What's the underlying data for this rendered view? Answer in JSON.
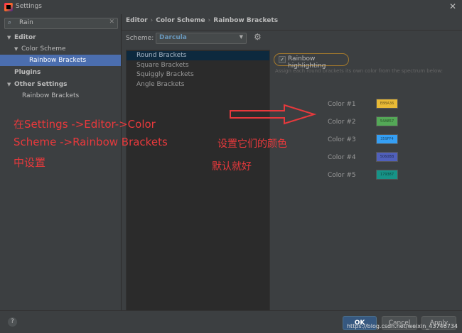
{
  "window": {
    "title": "Settings",
    "close_icon": "close-icon"
  },
  "sidebar": {
    "search_value": "Rain",
    "items": [
      {
        "label": "Editor"
      },
      {
        "label": "Color Scheme"
      },
      {
        "label": "Rainbow Brackets"
      },
      {
        "label": "Plugins"
      },
      {
        "label": "Other Settings"
      },
      {
        "label": "Rainbow Brackets"
      }
    ]
  },
  "breadcrumb": [
    "Editor",
    "Color Scheme",
    "Rainbow Brackets"
  ],
  "scheme": {
    "label": "Scheme:",
    "value": "Darcula"
  },
  "bracket_types": [
    "Round Brackets",
    "Square Brackets",
    "Squiggly Brackets",
    "Angle Brackets"
  ],
  "rainbow": {
    "label": "Rainbow highlighting",
    "checked": true,
    "description": "Assign each round brackets its own color from the spectrum below:"
  },
  "colors": [
    {
      "label": "Color #1",
      "hex": "#E8BA36",
      "code": "E8BA36"
    },
    {
      "label": "Color #2",
      "hex": "#54A857",
      "code": "54A857"
    },
    {
      "label": "Color #3",
      "hex": "#359FF4",
      "code": "359FF4"
    },
    {
      "label": "Color #4",
      "hex": "#5060BB",
      "code": "5060BB"
    },
    {
      "label": "Color #5",
      "hex": "#179387",
      "code": "179387"
    }
  ],
  "annotations": {
    "left_line1": "在Settings ->Editor->Color",
    "left_line2": "Scheme ->Rainbow Brackets",
    "left_line3": "中设置",
    "right_line1": "设置它们的颜色",
    "right_line2": "默认就好"
  },
  "buttons": {
    "ok": "OK",
    "cancel": "Cancel",
    "apply": "Apply",
    "help": "?"
  },
  "watermark": "https://blog.csdn.net/weixin_43746734"
}
